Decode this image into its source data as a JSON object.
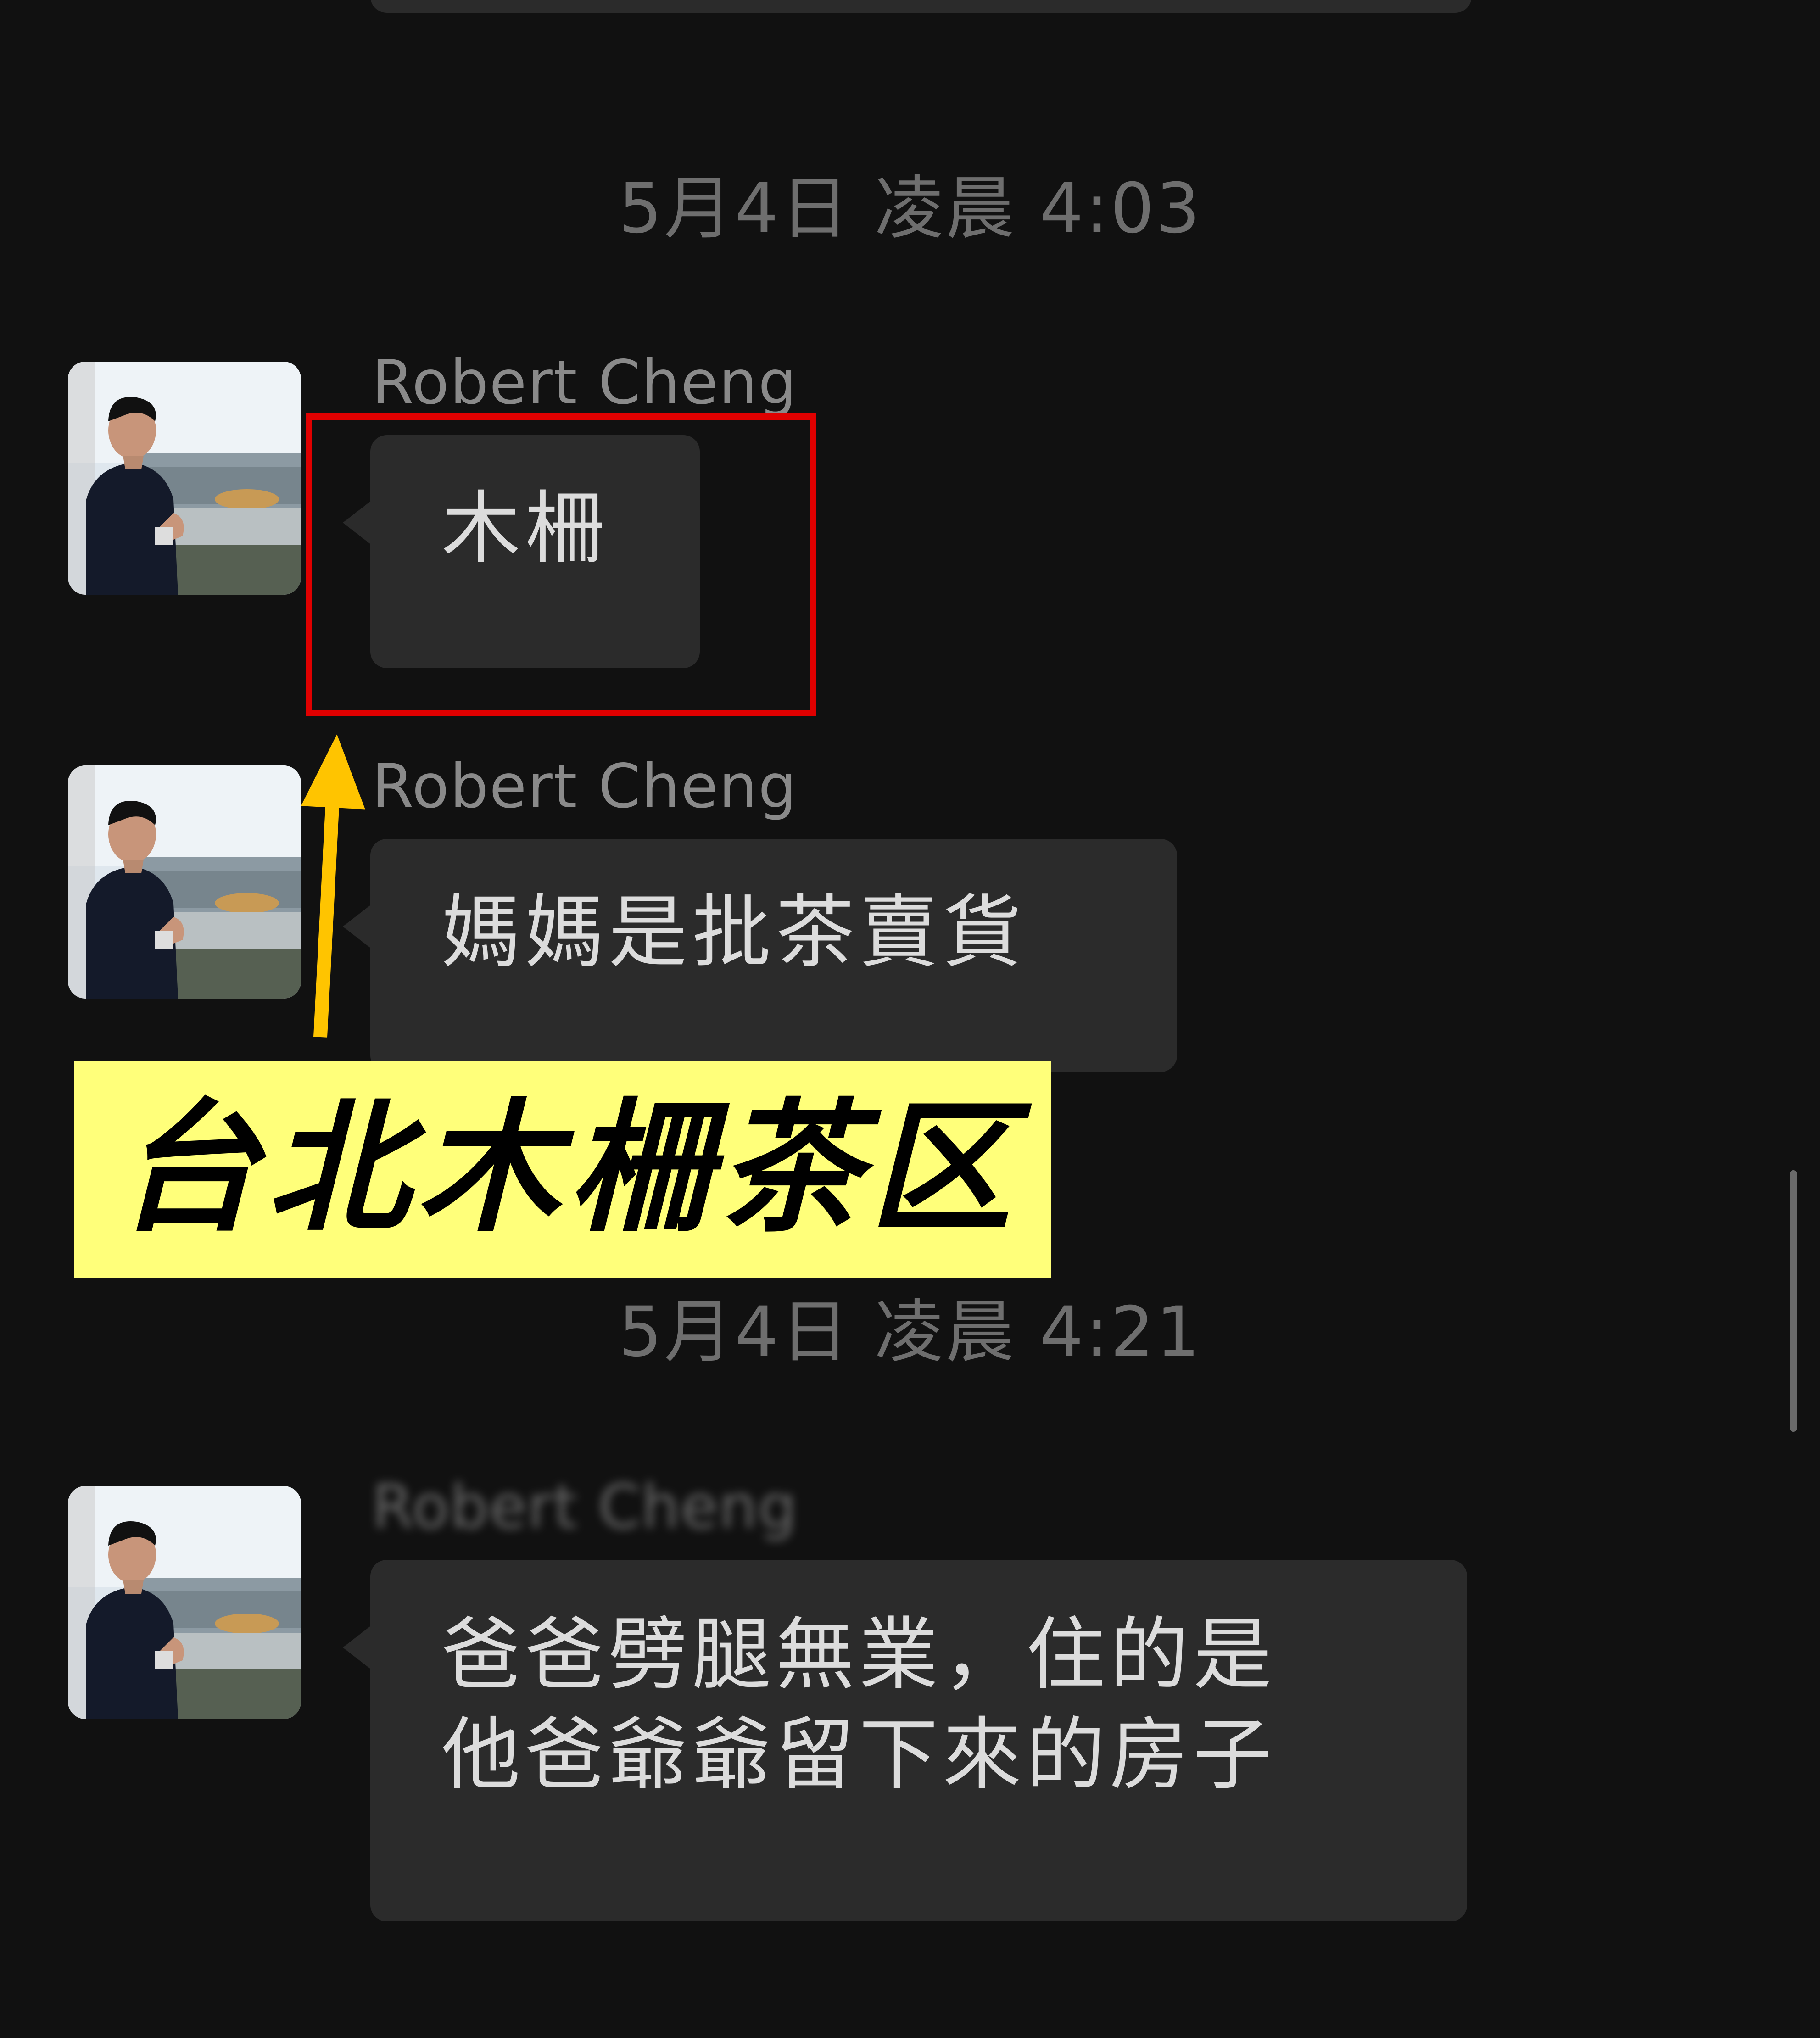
{
  "chat": {
    "timestamps": [
      "5月4日 凌晨 4:03",
      "5月4日 凌晨 4:21"
    ],
    "messages": [
      {
        "sender": "Robert Cheng",
        "text": "木柵"
      },
      {
        "sender": "Robert Cheng",
        "text": "媽媽是批茶賣貨"
      },
      {
        "sender": "Robert Cheng",
        "text_lines": [
          "爸爸劈腿無業，住的是",
          "他爸爺爺留下來的房子"
        ]
      }
    ]
  },
  "annotation": {
    "banner_text": "台北木柵茶区",
    "highlight_color": "#e00000",
    "arrow_color": "#ffc400",
    "banner_color": "#ffff7a"
  }
}
